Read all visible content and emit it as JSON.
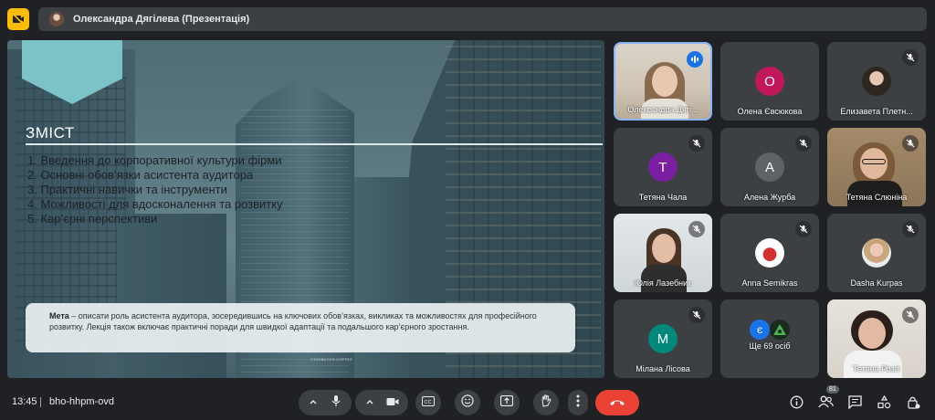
{
  "topbar": {
    "presenter_title": "Олександра Дягілева (Презентація)"
  },
  "slide": {
    "heading": "ЗМІСТ",
    "agenda": [
      "1.  Введення до корпоративної культури фірми",
      "2.  Основні обов’язки асистента аудитора",
      "3.  Практичні навички та інструменти",
      "4.  Можливості для вдосконалення та розвитку",
      "5.  Кар’єрні перспективи"
    ],
    "goal_label": "Мета",
    "goal_text": " – описати роль асистента аудитора, зосередившись на ключових обов’язках, викликах та можливостях для професійного розвитку. Лекція також включає практичні поради для швидкої адаптації та подальшого кар’єрного зростання.",
    "building_sign": "STARBUCKS COFFEE"
  },
  "participants": [
    {
      "name": "Олександра Дягі...",
      "type": "video",
      "status": "speaking"
    },
    {
      "name": "Олена Євсюкова",
      "type": "initial",
      "initial": "О",
      "color": "#c2185b",
      "status": "none"
    },
    {
      "name": "Елизавета Плетн...",
      "type": "photo",
      "status": "muted"
    },
    {
      "name": "Тетяна Чала",
      "type": "initial",
      "initial": "Т",
      "color": "#7b1fa2",
      "status": "muted"
    },
    {
      "name": "Алена Журба",
      "type": "initial",
      "initial": "А",
      "color": "#5f6368",
      "status": "muted"
    },
    {
      "name": "Тетяна Слюніна",
      "type": "video",
      "status": "muted"
    },
    {
      "name": "Юлія Лазебник",
      "type": "video",
      "status": "muted"
    },
    {
      "name": "Anna Semikras",
      "type": "photo",
      "status": "muted"
    },
    {
      "name": "Dasha Kurpas",
      "type": "photo",
      "status": "muted"
    },
    {
      "name": "Мілана Лісова",
      "type": "initial",
      "initial": "M",
      "color": "#00897b",
      "status": "muted"
    },
    {
      "name": "Ще 69 осіб",
      "type": "more",
      "initial": "є",
      "color": "#1a73e8",
      "status": "none"
    },
    {
      "name": "Тетяна Розіт",
      "type": "video",
      "status": "muted"
    }
  ],
  "bottom": {
    "time": "13:45",
    "meeting_code": "bho-hhpm-ovd",
    "people_count": "81",
    "colors": {
      "end_call": "#ea4335",
      "control_bg": "#3c4043",
      "accent": "#8ab4f8"
    },
    "icons": [
      "chevron-up-icon",
      "mic-icon",
      "chevron-up-icon",
      "camera-icon",
      "captions-icon",
      "emoji-icon",
      "present-icon",
      "raise-hand-icon",
      "more-vert-icon",
      "end-call-icon",
      "info-icon",
      "people-icon",
      "chat-icon",
      "activities-icon",
      "host-controls-icon"
    ]
  }
}
